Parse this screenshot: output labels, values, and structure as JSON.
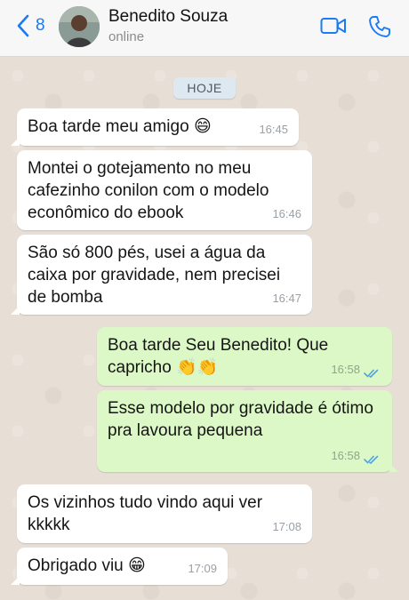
{
  "header": {
    "back_count": "8",
    "contact_name": "Benedito Souza",
    "status": "online"
  },
  "day_label": "HOJE",
  "messages": [
    {
      "text": "Boa tarde meu amigo 😄",
      "time": "16:45",
      "direction": "in"
    },
    {
      "text": "Montei o gotejamento no meu cafezinho conilon com o modelo econômico do ebook",
      "time": "16:46",
      "direction": "in"
    },
    {
      "text": "São só 800 pés, usei a água da caixa por gravidade, nem precisei de bomba",
      "time": "16:47",
      "direction": "in"
    },
    {
      "text": "Boa tarde Seu Benedito! Que capricho 👏👏",
      "time": "16:58",
      "direction": "out",
      "read": true
    },
    {
      "text": "Esse modelo por gravidade é ótimo pra lavoura pequena",
      "time": "16:58",
      "direction": "out",
      "read": true
    },
    {
      "text": "Os vizinhos tudo vindo aqui ver kkkkk",
      "time": "17:08",
      "direction": "in"
    },
    {
      "text": "Obrigado viu 😁",
      "time": "17:09",
      "direction": "in"
    }
  ],
  "colors": {
    "accent": "#1a7bf2",
    "incoming_bubble": "#ffffff",
    "outgoing_bubble": "#dcf8c6",
    "read_ticks": "#4fa3e0",
    "chat_background": "#e7ded6"
  }
}
